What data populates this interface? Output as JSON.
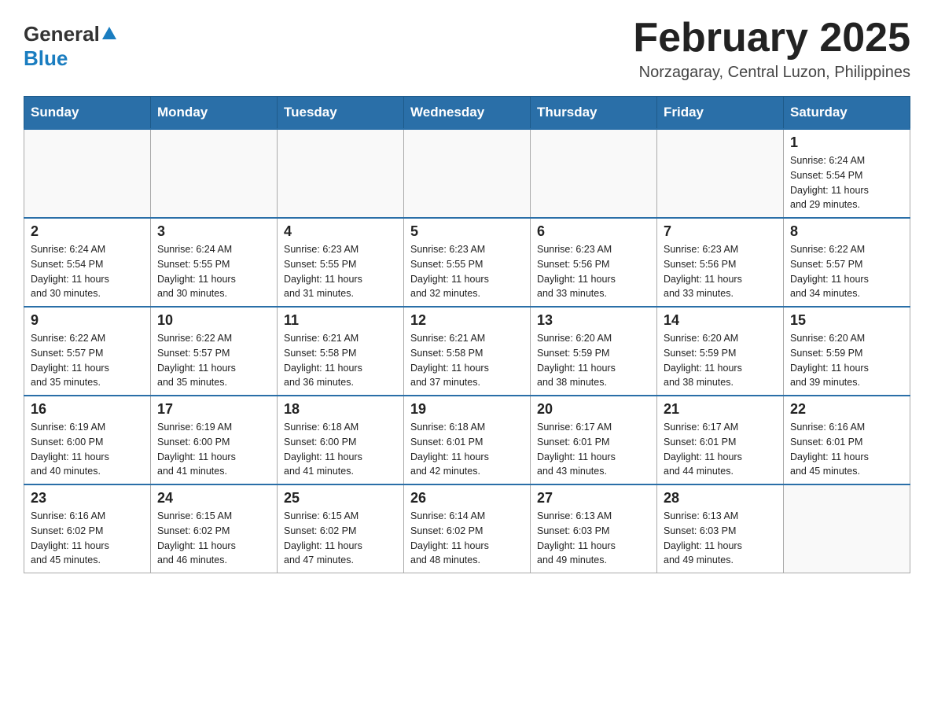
{
  "header": {
    "logo_general": "General",
    "logo_blue": "Blue",
    "calendar_title": "February 2025",
    "calendar_subtitle": "Norzagaray, Central Luzon, Philippines"
  },
  "weekdays": [
    "Sunday",
    "Monday",
    "Tuesday",
    "Wednesday",
    "Thursday",
    "Friday",
    "Saturday"
  ],
  "weeks": [
    [
      {
        "day": "",
        "info": ""
      },
      {
        "day": "",
        "info": ""
      },
      {
        "day": "",
        "info": ""
      },
      {
        "day": "",
        "info": ""
      },
      {
        "day": "",
        "info": ""
      },
      {
        "day": "",
        "info": ""
      },
      {
        "day": "1",
        "info": "Sunrise: 6:24 AM\nSunset: 5:54 PM\nDaylight: 11 hours\nand 29 minutes."
      }
    ],
    [
      {
        "day": "2",
        "info": "Sunrise: 6:24 AM\nSunset: 5:54 PM\nDaylight: 11 hours\nand 30 minutes."
      },
      {
        "day": "3",
        "info": "Sunrise: 6:24 AM\nSunset: 5:55 PM\nDaylight: 11 hours\nand 30 minutes."
      },
      {
        "day": "4",
        "info": "Sunrise: 6:23 AM\nSunset: 5:55 PM\nDaylight: 11 hours\nand 31 minutes."
      },
      {
        "day": "5",
        "info": "Sunrise: 6:23 AM\nSunset: 5:55 PM\nDaylight: 11 hours\nand 32 minutes."
      },
      {
        "day": "6",
        "info": "Sunrise: 6:23 AM\nSunset: 5:56 PM\nDaylight: 11 hours\nand 33 minutes."
      },
      {
        "day": "7",
        "info": "Sunrise: 6:23 AM\nSunset: 5:56 PM\nDaylight: 11 hours\nand 33 minutes."
      },
      {
        "day": "8",
        "info": "Sunrise: 6:22 AM\nSunset: 5:57 PM\nDaylight: 11 hours\nand 34 minutes."
      }
    ],
    [
      {
        "day": "9",
        "info": "Sunrise: 6:22 AM\nSunset: 5:57 PM\nDaylight: 11 hours\nand 35 minutes."
      },
      {
        "day": "10",
        "info": "Sunrise: 6:22 AM\nSunset: 5:57 PM\nDaylight: 11 hours\nand 35 minutes."
      },
      {
        "day": "11",
        "info": "Sunrise: 6:21 AM\nSunset: 5:58 PM\nDaylight: 11 hours\nand 36 minutes."
      },
      {
        "day": "12",
        "info": "Sunrise: 6:21 AM\nSunset: 5:58 PM\nDaylight: 11 hours\nand 37 minutes."
      },
      {
        "day": "13",
        "info": "Sunrise: 6:20 AM\nSunset: 5:59 PM\nDaylight: 11 hours\nand 38 minutes."
      },
      {
        "day": "14",
        "info": "Sunrise: 6:20 AM\nSunset: 5:59 PM\nDaylight: 11 hours\nand 38 minutes."
      },
      {
        "day": "15",
        "info": "Sunrise: 6:20 AM\nSunset: 5:59 PM\nDaylight: 11 hours\nand 39 minutes."
      }
    ],
    [
      {
        "day": "16",
        "info": "Sunrise: 6:19 AM\nSunset: 6:00 PM\nDaylight: 11 hours\nand 40 minutes."
      },
      {
        "day": "17",
        "info": "Sunrise: 6:19 AM\nSunset: 6:00 PM\nDaylight: 11 hours\nand 41 minutes."
      },
      {
        "day": "18",
        "info": "Sunrise: 6:18 AM\nSunset: 6:00 PM\nDaylight: 11 hours\nand 41 minutes."
      },
      {
        "day": "19",
        "info": "Sunrise: 6:18 AM\nSunset: 6:01 PM\nDaylight: 11 hours\nand 42 minutes."
      },
      {
        "day": "20",
        "info": "Sunrise: 6:17 AM\nSunset: 6:01 PM\nDaylight: 11 hours\nand 43 minutes."
      },
      {
        "day": "21",
        "info": "Sunrise: 6:17 AM\nSunset: 6:01 PM\nDaylight: 11 hours\nand 44 minutes."
      },
      {
        "day": "22",
        "info": "Sunrise: 6:16 AM\nSunset: 6:01 PM\nDaylight: 11 hours\nand 45 minutes."
      }
    ],
    [
      {
        "day": "23",
        "info": "Sunrise: 6:16 AM\nSunset: 6:02 PM\nDaylight: 11 hours\nand 45 minutes."
      },
      {
        "day": "24",
        "info": "Sunrise: 6:15 AM\nSunset: 6:02 PM\nDaylight: 11 hours\nand 46 minutes."
      },
      {
        "day": "25",
        "info": "Sunrise: 6:15 AM\nSunset: 6:02 PM\nDaylight: 11 hours\nand 47 minutes."
      },
      {
        "day": "26",
        "info": "Sunrise: 6:14 AM\nSunset: 6:02 PM\nDaylight: 11 hours\nand 48 minutes."
      },
      {
        "day": "27",
        "info": "Sunrise: 6:13 AM\nSunset: 6:03 PM\nDaylight: 11 hours\nand 49 minutes."
      },
      {
        "day": "28",
        "info": "Sunrise: 6:13 AM\nSunset: 6:03 PM\nDaylight: 11 hours\nand 49 minutes."
      },
      {
        "day": "",
        "info": ""
      }
    ]
  ]
}
